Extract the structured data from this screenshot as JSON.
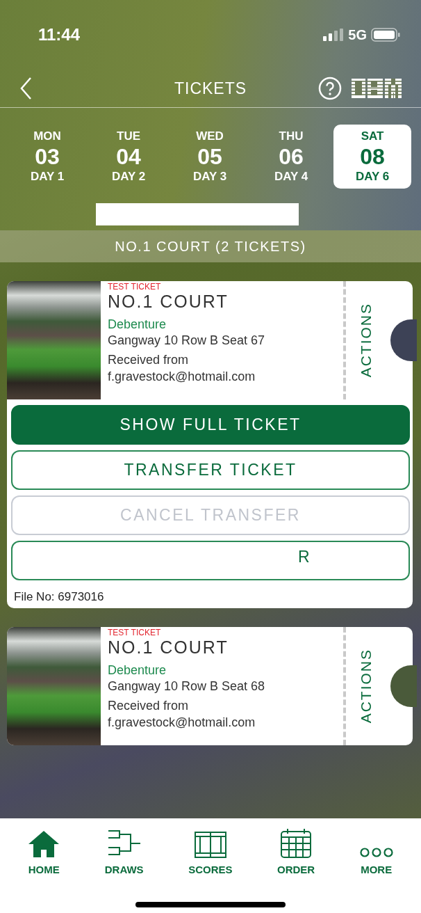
{
  "status_bar": {
    "time": "11:44",
    "network": "5G"
  },
  "header": {
    "title": "TICKETS"
  },
  "days": [
    {
      "weekday": "MON",
      "date": "03",
      "day": "DAY 1",
      "selected": false
    },
    {
      "weekday": "TUE",
      "date": "04",
      "day": "DAY 2",
      "selected": false
    },
    {
      "weekday": "WED",
      "date": "05",
      "day": "DAY 3",
      "selected": false
    },
    {
      "weekday": "THU",
      "date": "06",
      "day": "DAY 4",
      "selected": false
    },
    {
      "weekday": "SAT",
      "date": "08",
      "day": "DAY 6",
      "selected": true
    }
  ],
  "section": {
    "title": "NO.1 COURT (2 TICKETS)"
  },
  "tickets": [
    {
      "badge": "TEST TICKET",
      "court": "NO.1 COURT",
      "category": "Debenture",
      "seat": "Gangway 10 Row B Seat 67",
      "received_label": "Received from",
      "sender": "f.gravestock@hotmail.com",
      "actions_label": "ACTIONS",
      "expanded": true,
      "buttons": [
        {
          "label": "SHOW FULL TICKET",
          "kind": "primary"
        },
        {
          "label": "TRANSFER TICKET",
          "kind": "outline"
        },
        {
          "label": "CANCEL TRANSFER",
          "kind": "disabled"
        },
        {
          "label": "R",
          "kind": "outline-clipped"
        }
      ],
      "file_no": "File No: 6973016"
    },
    {
      "badge": "TEST TICKET",
      "court": "NO.1 COURT",
      "category": "Debenture",
      "seat": "Gangway 10 Row B Seat 68",
      "received_label": "Received from",
      "sender": "f.gravestock@hotmail.com",
      "actions_label": "ACTIONS",
      "expanded": false
    }
  ],
  "nav": [
    {
      "label": "HOME",
      "kind": "home"
    },
    {
      "label": "DRAWS",
      "kind": "draws"
    },
    {
      "label": "SCORES",
      "kind": "scores"
    },
    {
      "label": "ORDER",
      "kind": "order"
    },
    {
      "label": "MORE",
      "kind": "more"
    }
  ]
}
